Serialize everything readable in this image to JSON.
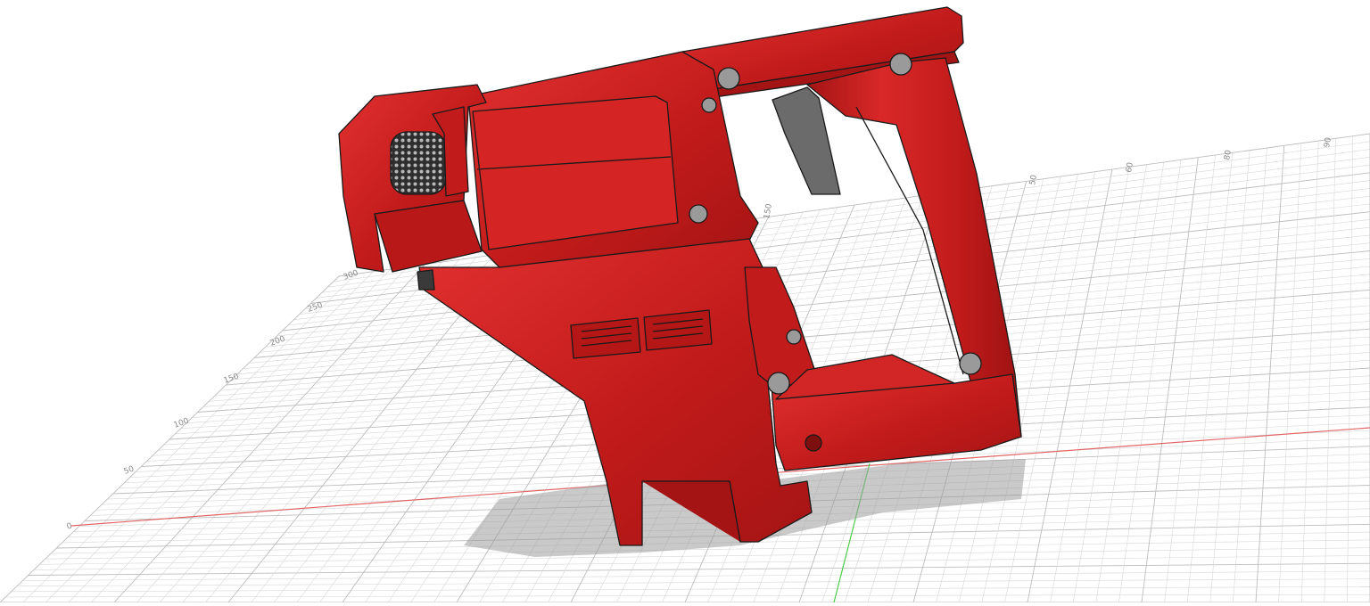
{
  "viewport": {
    "background": "#ffffff",
    "grid": {
      "visible": true,
      "minor_color": "#d7d7d7",
      "major_color": "#bdbdbd",
      "x_axis_color": "#e06666",
      "y_axis_color": "#4ccc4c",
      "left_ticks": [
        "0",
        "50",
        "100",
        "150",
        "200",
        "250",
        "300"
      ],
      "top_ticks": [
        "150",
        "50",
        "60",
        "80",
        "90"
      ]
    },
    "model": {
      "name": "red-tool-housing",
      "body_color": "#c21b1b",
      "highlight_color": "#e23030",
      "shade_color": "#a51414",
      "trigger_color": "#6b6b6b",
      "vent_color": "#3a3a3a",
      "screw_color": "#9a9a9a"
    }
  }
}
